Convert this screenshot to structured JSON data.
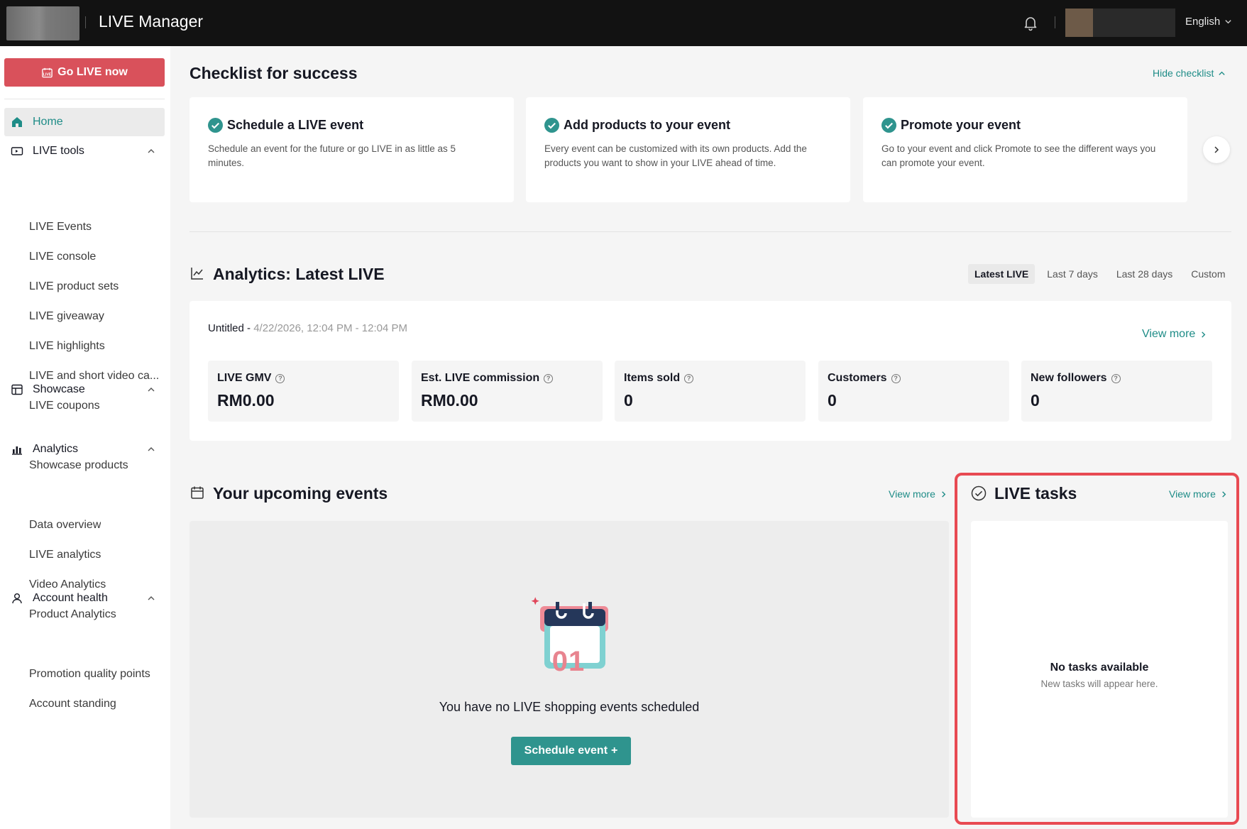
{
  "topbar": {
    "title": "LIVE Manager",
    "language": "English",
    "icons": {
      "bell": "bell-icon",
      "chevron": "chevron-down-icon"
    }
  },
  "sidebar": {
    "go_live_label": "Go LIVE now",
    "items": [
      {
        "label": "Home",
        "icon": "home-icon",
        "active": true
      },
      {
        "label": "LIVE tools",
        "icon": "live-tools-icon",
        "expanded": true,
        "children": [
          "LIVE Events",
          "LIVE console",
          "LIVE product sets",
          "LIVE giveaway",
          "LIVE highlights",
          "LIVE and short video ca...",
          "LIVE coupons"
        ]
      },
      {
        "label": "Showcase",
        "icon": "showcase-icon",
        "expanded": true,
        "children": [
          "Showcase products"
        ]
      },
      {
        "label": "Analytics",
        "icon": "analytics-icon",
        "expanded": true,
        "children": [
          "Data overview",
          "LIVE analytics",
          "Video Analytics",
          "Product Analytics"
        ]
      },
      {
        "label": "Account health",
        "icon": "account-icon",
        "expanded": true,
        "children": [
          "Promotion quality points",
          "Account standing"
        ]
      }
    ]
  },
  "checklist": {
    "title": "Checklist for success",
    "hide_label": "Hide checklist",
    "cards": [
      {
        "title": "Schedule a LIVE event",
        "desc": "Schedule an event for the future or go LIVE in as little as 5 minutes."
      },
      {
        "title": "Add products to your event",
        "desc": "Every event can be customized with its own products. Add the products you want to show in your LIVE ahead of time."
      },
      {
        "title": "Promote your event",
        "desc": "Go to your event and click Promote to see the different ways you can promote your event."
      }
    ]
  },
  "analytics": {
    "title": "Analytics: Latest LIVE",
    "tabs": [
      "Latest LIVE",
      "Last 7 days",
      "Last 28 days",
      "Custom"
    ],
    "active_tab": "Latest LIVE",
    "session_name": "Untitled - ",
    "session_time": "4/22/2026, 12:04 PM - 12:04 PM",
    "view_more": "View more",
    "stats": [
      {
        "label": "LIVE GMV",
        "value": "RM0.00"
      },
      {
        "label": "Est. LIVE commission",
        "value": "RM0.00"
      },
      {
        "label": "Items sold",
        "value": "0"
      },
      {
        "label": "Customers",
        "value": "0"
      },
      {
        "label": "New followers",
        "value": "0"
      }
    ]
  },
  "upcoming": {
    "title": "Your upcoming events",
    "view_more": "View more",
    "calendar_number": "01",
    "empty_text": "You have no LIVE shopping events scheduled",
    "schedule_label": "Schedule event",
    "schedule_plus": "+"
  },
  "tasks": {
    "title": "LIVE tasks",
    "view_more": "View more",
    "empty_title": "No tasks available",
    "empty_desc": "New tasks will appear here."
  },
  "colors": {
    "accent": "#1e8c87",
    "brand_red": "#d9515b",
    "highlight": "#e84a52",
    "topbar": "#121212"
  }
}
